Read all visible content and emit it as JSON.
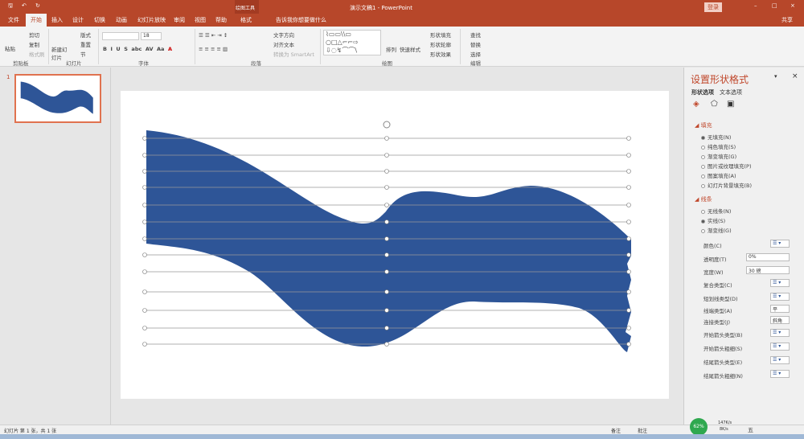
{
  "window": {
    "title": "演示文稿1 - PowerPoint",
    "context_tool": "绘图工具",
    "login": "登录",
    "share": "共享"
  },
  "tabs": [
    {
      "label": "文件"
    },
    {
      "label": "开始"
    },
    {
      "label": "插入"
    },
    {
      "label": "设计"
    },
    {
      "label": "切换"
    },
    {
      "label": "动画"
    },
    {
      "label": "幻灯片放映"
    },
    {
      "label": "审阅"
    },
    {
      "label": "视图"
    },
    {
      "label": "帮助"
    },
    {
      "label": "格式"
    }
  ],
  "tell_me": "告诉我你想要做什么",
  "ribbon": {
    "clipboard": {
      "paste": "粘贴",
      "cut": "剪切",
      "copy": "复制",
      "format_painter": "格式刷",
      "label": "剪贴板"
    },
    "slides": {
      "new_slide": "新建幻灯片",
      "layout": "版式",
      "reset": "重置",
      "section": "节",
      "label": "幻灯片"
    },
    "font": {
      "font_size": "18",
      "label": "字体"
    },
    "paragraph": {
      "text_direction": "文字方向",
      "align_text": "对齐文本",
      "smartart": "转换为 SmartArt",
      "label": "段落"
    },
    "drawing": {
      "arrange": "排列",
      "quick_styles": "快速样式",
      "shape_fill": "形状填充",
      "shape_outline": "形状轮廓",
      "shape_effects": "形状效果",
      "label": "绘图"
    },
    "editing": {
      "find": "查找",
      "replace": "替换",
      "select": "选择",
      "label": "编辑"
    }
  },
  "slide_number": "1",
  "pane": {
    "title": "设置形状格式",
    "tab1": "形状选项",
    "tab2": "文本选项",
    "fill_section": "填充",
    "fill_options": [
      {
        "label": "无填充(N)",
        "on": true
      },
      {
        "label": "纯色填充(S)",
        "on": false
      },
      {
        "label": "渐变填充(G)",
        "on": false
      },
      {
        "label": "图片或纹理填充(P)",
        "on": false
      },
      {
        "label": "图案填充(A)",
        "on": false
      },
      {
        "label": "幻灯片背景填充(B)",
        "on": false
      }
    ],
    "line_section": "线条",
    "line_options": [
      {
        "label": "无线条(N)",
        "on": false
      },
      {
        "label": "实线(S)",
        "on": true
      },
      {
        "label": "渐变线(G)",
        "on": false
      }
    ],
    "props": [
      {
        "label": "颜色(C)",
        "value": ""
      },
      {
        "label": "透明度(T)",
        "value": "0%"
      },
      {
        "label": "宽度(W)",
        "value": "30 磅"
      },
      {
        "label": "复合类型(C)",
        "value": ""
      },
      {
        "label": "短划线类型(D)",
        "value": ""
      },
      {
        "label": "线端类型(A)",
        "value": "平"
      },
      {
        "label": "连接类型(J)",
        "value": "斜角"
      },
      {
        "label": "开始箭头类型(B)",
        "value": ""
      },
      {
        "label": "开始箭头粗细(S)",
        "value": ""
      },
      {
        "label": "结尾箭头类型(E)",
        "value": ""
      },
      {
        "label": "结尾箭头粗细(N)",
        "value": ""
      }
    ]
  },
  "status": {
    "slide_info": "幻灯片 第 1 张，共 1 张",
    "notes": "备注",
    "comments": "批注",
    "net_percent": "62%",
    "up": "147K/s",
    "down": "8K/s",
    "ime": "五"
  },
  "colors": {
    "accent": "#b7472a",
    "shape": "#2e5597"
  }
}
